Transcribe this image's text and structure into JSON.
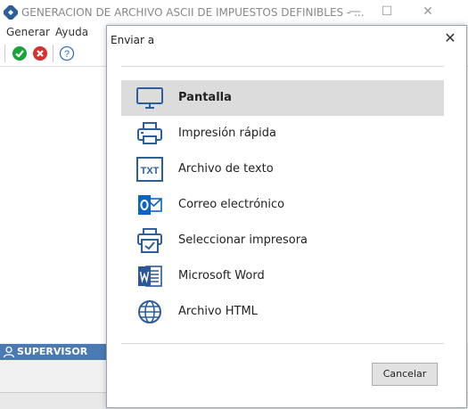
{
  "window": {
    "title": "GENERACION DE ARCHIVO ASCII DE IMPUESTOS DEFINIBLES - ...",
    "minimize": "—",
    "maximize": "☐",
    "close": "✕"
  },
  "menubar": {
    "items": [
      "Generar",
      "Ayuda"
    ]
  },
  "toolbar": {
    "buttons": [
      {
        "icon": "check-icon",
        "color": "#1aa33a"
      },
      {
        "icon": "cancel-icon",
        "color": "#d63030"
      },
      {
        "icon": "help-icon",
        "color": "#3b6fb0"
      }
    ]
  },
  "status": {
    "user_label": "SUPERVISOR",
    "user_color": "#4a7ab5"
  },
  "dialog": {
    "title": "Enviar a",
    "close": "✕",
    "options": [
      {
        "label": "Pantalla",
        "icon": "monitor-icon",
        "selected": true
      },
      {
        "label": "Impresión rápida",
        "icon": "printer-icon",
        "selected": false
      },
      {
        "label": "Archivo de texto",
        "icon": "txt-file-icon",
        "selected": false
      },
      {
        "label": "Correo electrónico",
        "icon": "outlook-icon",
        "selected": false
      },
      {
        "label": "Seleccionar impresora",
        "icon": "printer-select-icon",
        "selected": false
      },
      {
        "label": "Microsoft Word",
        "icon": "word-icon",
        "selected": false
      },
      {
        "label": "Archivo HTML",
        "icon": "globe-icon",
        "selected": false
      }
    ],
    "cancel_label": "Cancelar"
  }
}
